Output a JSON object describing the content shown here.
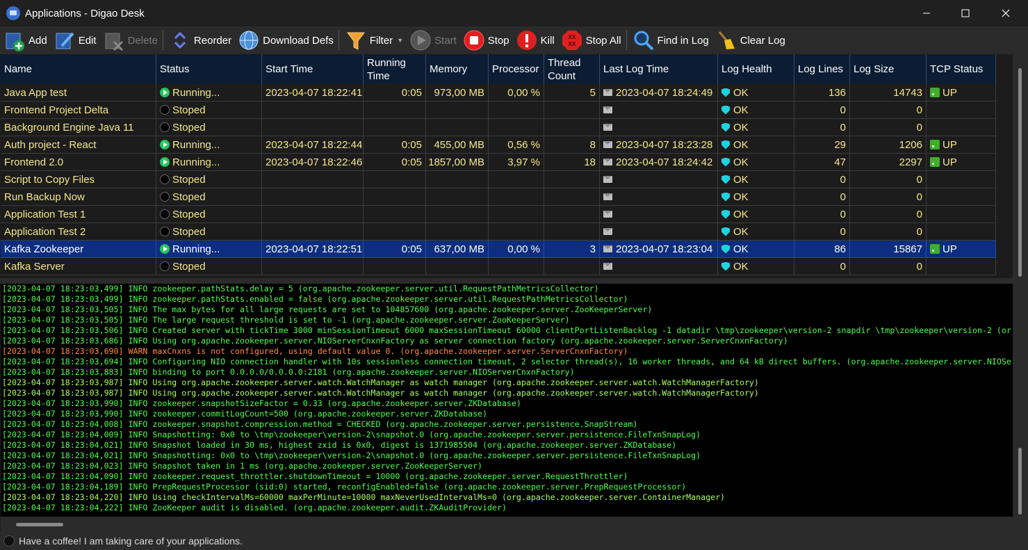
{
  "window": {
    "title": "Applications - Digao Desk"
  },
  "toolbar": {
    "add": "Add",
    "edit": "Edit",
    "delete": "Delete",
    "reorder": "Reorder",
    "download_defs": "Download Defs",
    "filter": "Filter",
    "start": "Start",
    "stop": "Stop",
    "kill": "Kill",
    "stop_all": "Stop All",
    "find_in_log": "Find in Log",
    "clear_log": "Clear Log"
  },
  "grid": {
    "columns": [
      "Name",
      "Status",
      "Start Time",
      "Running Time",
      "Memory",
      "Processor",
      "Thread Count",
      "Last Log Time",
      "Log Health",
      "Log Lines",
      "Log Size",
      "TCP Status"
    ],
    "rows": [
      {
        "name": "Java App test",
        "status": "Running...",
        "running": true,
        "start_time": "2023-04-07 18:22:41",
        "running_time": "0:05",
        "memory": "973,00 MB",
        "processor": "0,00 %",
        "thread_count": "5",
        "last_log_time": "2023-04-07 18:24:49",
        "log_health": "OK",
        "log_lines": "136",
        "log_size": "14743",
        "tcp_status": "UP",
        "selected": false
      },
      {
        "name": "Frontend Project Delta",
        "status": "Stoped",
        "running": false,
        "start_time": "",
        "running_time": "",
        "memory": "",
        "processor": "",
        "thread_count": "",
        "last_log_time": "",
        "log_health": "OK",
        "log_lines": "0",
        "log_size": "0",
        "tcp_status": "",
        "selected": false
      },
      {
        "name": "Background Engine Java 11",
        "status": "Stoped",
        "running": false,
        "start_time": "",
        "running_time": "",
        "memory": "",
        "processor": "",
        "thread_count": "",
        "last_log_time": "",
        "log_health": "OK",
        "log_lines": "0",
        "log_size": "0",
        "tcp_status": "",
        "selected": false
      },
      {
        "name": "Auth project - React",
        "status": "Running...",
        "running": true,
        "start_time": "2023-04-07 18:22:44",
        "running_time": "0:05",
        "memory": "455,00 MB",
        "processor": "0,56 %",
        "thread_count": "8",
        "last_log_time": "2023-04-07 18:23:28",
        "log_health": "OK",
        "log_lines": "29",
        "log_size": "1206",
        "tcp_status": "UP",
        "selected": false
      },
      {
        "name": "Frontend 2.0",
        "status": "Running...",
        "running": true,
        "start_time": "2023-04-07 18:22:46",
        "running_time": "0:05",
        "memory": "1857,00 MB",
        "processor": "3,97 %",
        "thread_count": "18",
        "last_log_time": "2023-04-07 18:24:42",
        "log_health": "OK",
        "log_lines": "47",
        "log_size": "2297",
        "tcp_status": "UP",
        "selected": false
      },
      {
        "name": "Script to Copy Files",
        "status": "Stoped",
        "running": false,
        "start_time": "",
        "running_time": "",
        "memory": "",
        "processor": "",
        "thread_count": "",
        "last_log_time": "",
        "log_health": "OK",
        "log_lines": "0",
        "log_size": "0",
        "tcp_status": "",
        "selected": false
      },
      {
        "name": "Run Backup Now",
        "status": "Stoped",
        "running": false,
        "start_time": "",
        "running_time": "",
        "memory": "",
        "processor": "",
        "thread_count": "",
        "last_log_time": "",
        "log_health": "OK",
        "log_lines": "0",
        "log_size": "0",
        "tcp_status": "",
        "selected": false
      },
      {
        "name": "Application Test 1",
        "status": "Stoped",
        "running": false,
        "start_time": "",
        "running_time": "",
        "memory": "",
        "processor": "",
        "thread_count": "",
        "last_log_time": "",
        "log_health": "OK",
        "log_lines": "0",
        "log_size": "0",
        "tcp_status": "",
        "selected": false
      },
      {
        "name": "Application Test 2",
        "status": "Stoped",
        "running": false,
        "start_time": "",
        "running_time": "",
        "memory": "",
        "processor": "",
        "thread_count": "",
        "last_log_time": "",
        "log_health": "OK",
        "log_lines": "0",
        "log_size": "0",
        "tcp_status": "",
        "selected": false
      },
      {
        "name": "Kafka Zookeeper",
        "status": "Running...",
        "running": true,
        "start_time": "2023-04-07 18:22:51",
        "running_time": "0:05",
        "memory": "637,00 MB",
        "processor": "0,00 %",
        "thread_count": "3",
        "last_log_time": "2023-04-07 18:23:04",
        "log_health": "OK",
        "log_lines": "86",
        "log_size": "15867",
        "tcp_status": "UP",
        "selected": true
      },
      {
        "name": "Kafka Server",
        "status": "Stoped",
        "running": false,
        "start_time": "",
        "running_time": "",
        "memory": "",
        "processor": "",
        "thread_count": "",
        "last_log_time": "",
        "log_health": "OK",
        "log_lines": "0",
        "log_size": "0",
        "tcp_status": "",
        "selected": false
      }
    ]
  },
  "log": {
    "lines": [
      {
        "text": "[2023-04-07 18:23:03,499] INFO zookeeper.pathStats.delay = 5 (org.apache.zookeeper.server.util.RequestPathMetricsCollector)",
        "level": "info"
      },
      {
        "text": "[2023-04-07 18:23:03,499] INFO zookeeper.pathStats.enabled = false (org.apache.zookeeper.server.util.RequestPathMetricsCollector)",
        "level": "info"
      },
      {
        "text": "[2023-04-07 18:23:03,505] INFO The max bytes for all large requests are set to 104857600 (org.apache.zookeeper.server.ZooKeeperServer)",
        "level": "info"
      },
      {
        "text": "[2023-04-07 18:23:03,505] INFO The large request threshold is set to -1 (org.apache.zookeeper.server.ZooKeeperServer)",
        "level": "info"
      },
      {
        "text": "[2023-04-07 18:23:03,506] INFO Created server with tickTime 3000 minSessionTimeout 6000 maxSessionTimeout 60000 clientPortListenBacklog -1 datadir \\tmp\\zookeeper\\version-2 snapdir \\tmp\\zookeeper\\version-2 (or",
        "level": "info"
      },
      {
        "text": "[2023-04-07 18:23:03,686] INFO Using org.apache.zookeeper.server.NIOServerCnxnFactory as server connection factory (org.apache.zookeeper.server.ServerCnxnFactory)",
        "level": "info"
      },
      {
        "text": "[2023-04-07 18:23:03,690] WARN maxCnxns is not configured, using default value 0. (org.apache.zookeeper.server.ServerCnxnFactory)",
        "level": "warn"
      },
      {
        "text": "[2023-04-07 18:23:03,694] INFO Configuring NIO connection handler with 10s sessionless connection timeout, 2 selector thread(s), 16 worker threads, and 64 kB direct buffers. (org.apache.zookeeper.server.NIOSe",
        "level": "info"
      },
      {
        "text": "[2023-04-07 18:23:03,883] INFO binding to port 0.0.0.0/0.0.0.0:2181 (org.apache.zookeeper.server.NIOServerCnxnFactory)",
        "level": "info"
      },
      {
        "text": "[2023-04-07 18:23:03,987] INFO Using org.apache.zookeeper.server.watch.WatchManager as watch manager (org.apache.zookeeper.server.watch.WatchManagerFactory)",
        "level": "used"
      },
      {
        "text": "[2023-04-07 18:23:03,987] INFO Using org.apache.zookeeper.server.watch.WatchManager as watch manager (org.apache.zookeeper.server.watch.WatchManagerFactory)",
        "level": "used"
      },
      {
        "text": "[2023-04-07 18:23:03,990] INFO zookeeper.snapshotSizeFactor = 0.33 (org.apache.zookeeper.server.ZKDatabase)",
        "level": "info"
      },
      {
        "text": "[2023-04-07 18:23:03,990] INFO zookeeper.commitLogCount=500 (org.apache.zookeeper.server.ZKDatabase)",
        "level": "info"
      },
      {
        "text": "[2023-04-07 18:23:04,008] INFO zookeeper.snapshot.compression.method = CHECKED (org.apache.zookeeper.server.persistence.SnapStream)",
        "level": "info"
      },
      {
        "text": "[2023-04-07 18:23:04,009] INFO Snapshotting: 0x0 to \\tmp\\zookeeper\\version-2\\snapshot.0 (org.apache.zookeeper.server.persistence.FileTxnSnapLog)",
        "level": "info"
      },
      {
        "text": "[2023-04-07 18:23:04,021] INFO Snapshot loaded in 30 ms, highest zxid is 0x0, digest is 1371985504 (org.apache.zookeeper.server.ZKDatabase)",
        "level": "info"
      },
      {
        "text": "[2023-04-07 18:23:04,021] INFO Snapshotting: 0x0 to \\tmp\\zookeeper\\version-2\\snapshot.0 (org.apache.zookeeper.server.persistence.FileTxnSnapLog)",
        "level": "info"
      },
      {
        "text": "[2023-04-07 18:23:04,023] INFO Snapshot taken in 1 ms (org.apache.zookeeper.server.ZooKeeperServer)",
        "level": "info"
      },
      {
        "text": "[2023-04-07 18:23:04,090] INFO zookeeper.request_throttler.shutdownTimeout = 10000 (org.apache.zookeeper.server.RequestThrottler)",
        "level": "info"
      },
      {
        "text": "[2023-04-07 18:23:04,189] INFO PrepRequestProcessor (sid:0) started, reconfigEnabled=false (org.apache.zookeeper.server.PrepRequestProcessor)",
        "level": "info"
      },
      {
        "text": "[2023-04-07 18:23:04,220] INFO Using checkIntervalMs=60000 maxPerMinute=10000 maxNeverUsedIntervalMs=0 (org.apache.zookeeper.server.ContainerManager)",
        "level": "used"
      },
      {
        "text": "[2023-04-07 18:23:04,222] INFO ZooKeeper audit is disabled. (org.apache.zookeeper.audit.ZKAuditProvider)",
        "level": "info"
      }
    ]
  },
  "statusbar": {
    "text": "Have a coffee! I am taking care of your applications."
  },
  "colors": {
    "grid_text": "#f5e88a",
    "header_bg": "#0b1c33",
    "selected_row": "#0d2e80",
    "log_info": "#4cff4c",
    "log_warn": "#ff8a3c"
  }
}
